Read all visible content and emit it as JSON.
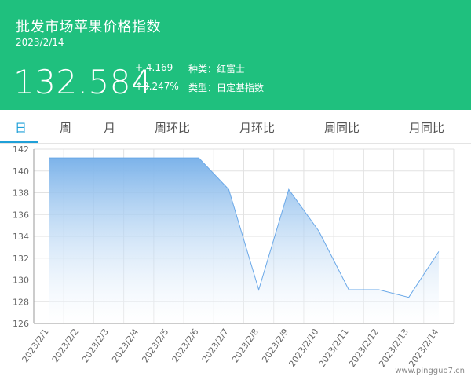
{
  "header": {
    "title": "批发市场苹果价格指数",
    "date": "2023/2/14",
    "value": "132.584",
    "change_abs": "+ 4.169",
    "change_pct": "↑3.247%",
    "variety": "种类：红富士",
    "index_type": "类型：日定基指数"
  },
  "tabs": [
    "日",
    "周",
    "月",
    "周环比",
    "月环比",
    "周同比",
    "月同比"
  ],
  "active_tab": 0,
  "colors": {
    "header_bg": "#1fc07e",
    "accent": "#1fa0d8",
    "area_top": "#7cb3ea",
    "line": "#6aa8e8"
  },
  "watermark": "www.pingguo7.cn",
  "chart_data": {
    "type": "area",
    "title": "",
    "xlabel": "",
    "ylabel": "",
    "x": [
      "2023/2/1",
      "2023/2/2",
      "2023/2/3",
      "2023/2/4",
      "2023/2/5",
      "2023/2/6",
      "2023/2/7",
      "2023/2/8",
      "2023/2/9",
      "2023/2/10",
      "2023/2/11",
      "2023/2/12",
      "2023/2/13",
      "2023/2/14"
    ],
    "values": [
      141.2,
      141.2,
      141.2,
      141.2,
      141.2,
      141.2,
      138.3,
      129.1,
      138.3,
      134.5,
      129.1,
      129.1,
      128.4,
      132.6
    ],
    "ylim": [
      126,
      142
    ],
    "yticks": [
      126,
      128,
      130,
      132,
      134,
      136,
      138,
      140,
      142
    ],
    "grid": true
  }
}
